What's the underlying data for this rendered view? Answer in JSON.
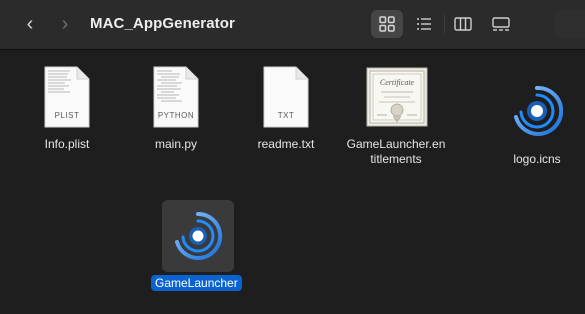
{
  "window": {
    "title": "MAC_AppGenerator"
  },
  "toolbar": {
    "back_icon": "chevron-left-icon",
    "forward_icon": "chevron-right-icon",
    "views": [
      {
        "name": "icons",
        "icon": "grid-view-icon",
        "selected": true
      },
      {
        "name": "list",
        "icon": "list-view-icon",
        "selected": false
      },
      {
        "name": "columns",
        "icon": "column-view-icon",
        "selected": false
      },
      {
        "name": "gallery",
        "icon": "gallery-view-icon",
        "selected": false
      }
    ]
  },
  "files": {
    "info_plist": {
      "label": "Info.plist",
      "type": "PLIST",
      "icon": "plist-document-icon"
    },
    "main_py": {
      "label": "main.py",
      "type": "PYTHON",
      "icon": "python-document-icon"
    },
    "readme_txt": {
      "label": "readme.txt",
      "type": "TXT",
      "icon": "text-document-icon"
    },
    "entitlements": {
      "label_line1": "GameLauncher.en",
      "label_line2": "titlements",
      "icon": "certificate-icon"
    },
    "logo_icns": {
      "label": "logo.icns",
      "icon": "gamelauncher-logo-icon"
    },
    "gamelauncher": {
      "label": "GameLauncher",
      "icon": "gamelauncher-app-icon",
      "selected": true
    }
  },
  "colors": {
    "background": "#1e1e1e",
    "toolbar": "#2b2b2b",
    "selection": "#0b63d1",
    "logo_blue": "#1e8cff",
    "logo_light": "#8dc4ff"
  }
}
